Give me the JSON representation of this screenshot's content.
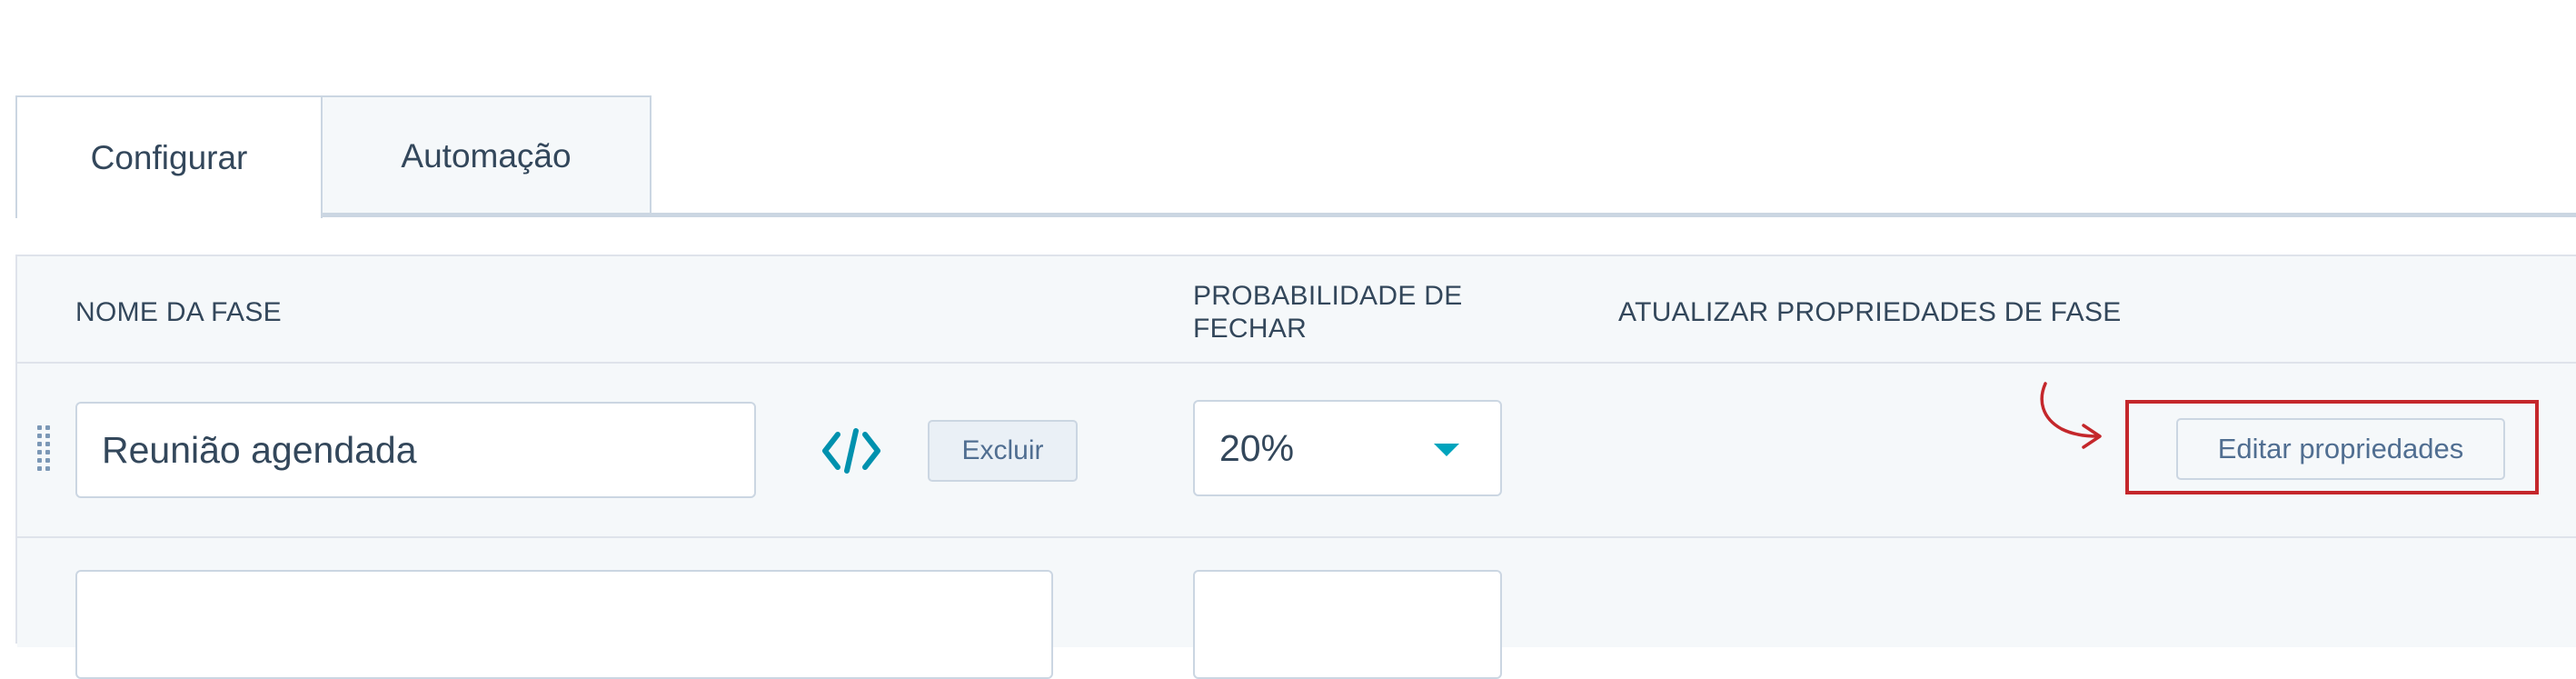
{
  "tabs": [
    {
      "label": "Configurar",
      "active": true
    },
    {
      "label": "Automação",
      "active": false
    }
  ],
  "table": {
    "headers": {
      "stage_name": "NOME DA FASE",
      "close_probability": "PROBABILIDADE DE FECHAR",
      "update_properties": "ATUALIZAR PROPRIEDADES DE FASE"
    },
    "rows": [
      {
        "stage_name": "Reunião agendada",
        "delete_label": "Excluir",
        "probability": "20%",
        "edit_label": "Editar propriedades"
      }
    ]
  },
  "colors": {
    "text": "#33475b",
    "border": "#cbd6e2",
    "header_bg": "#f5f8fa",
    "accent": "#00a4bd",
    "highlight": "#c4272b"
  },
  "icons": {
    "drag": "drag-handle-icon",
    "embed": "code-icon",
    "dropdown": "caret-down-icon",
    "annotation": "curved-arrow-icon"
  }
}
